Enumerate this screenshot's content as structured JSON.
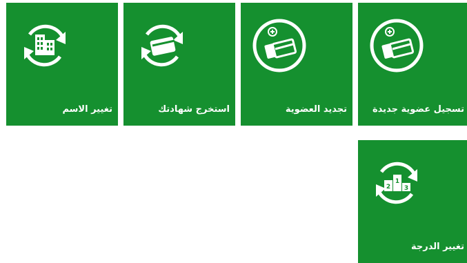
{
  "tiles": [
    {
      "label": "تسجيل عضوية جديدة",
      "icon": "new-membership-cards-icon"
    },
    {
      "label": "تجديد العضوية",
      "icon": "renew-membership-cards-icon"
    },
    {
      "label": "استخرج شهادتك",
      "icon": "certificate-card-refresh-icon"
    },
    {
      "label": "تغيير الاسم",
      "icon": "building-refresh-icon"
    },
    {
      "label": "تغيير الدرجة",
      "icon": "podium-refresh-icon"
    }
  ],
  "colors": {
    "tile_background": "#15902f",
    "icon": "#ffffff",
    "page_background": "#ffffff"
  }
}
